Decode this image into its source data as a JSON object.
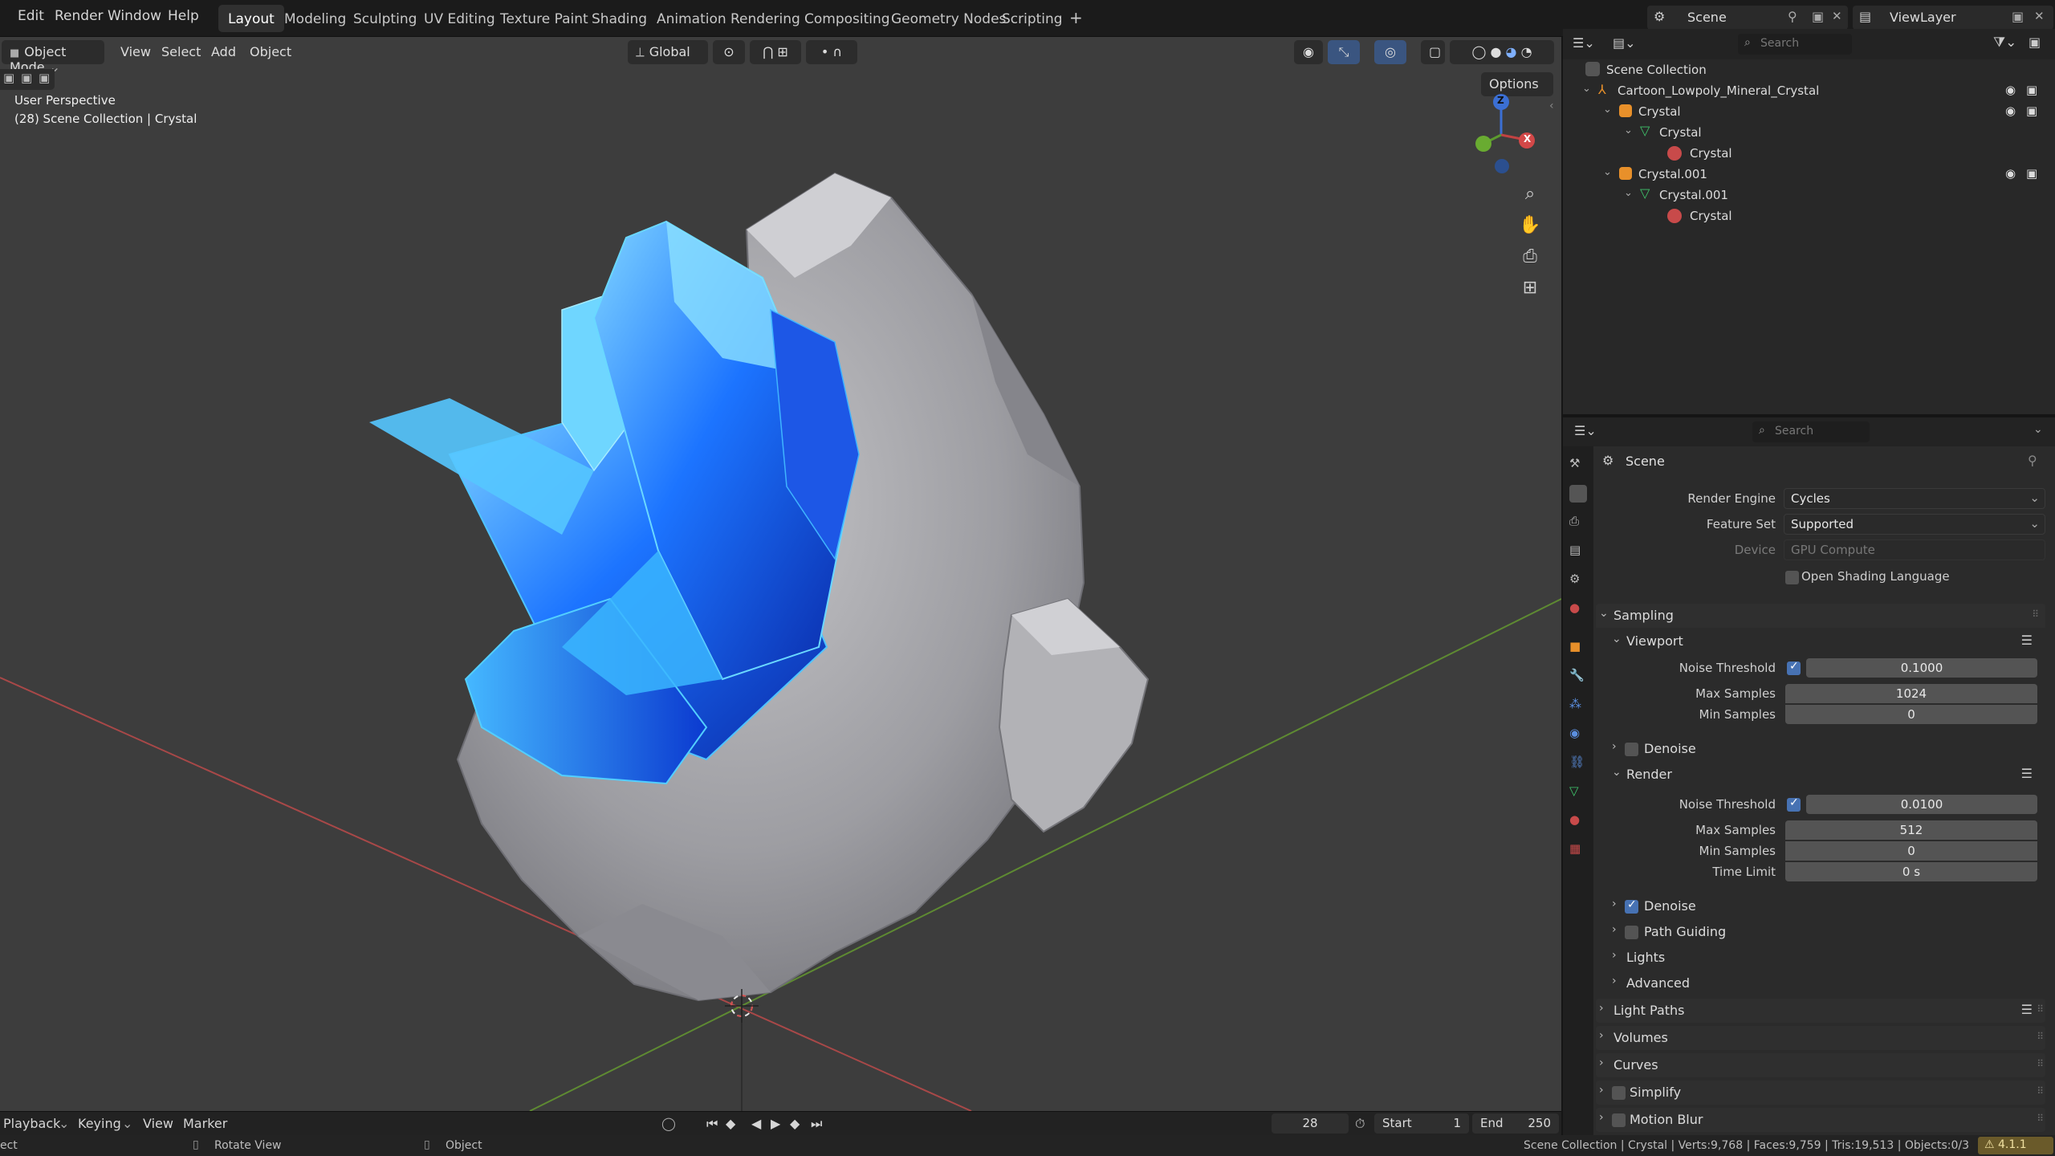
{
  "topbar": {
    "menus": [
      "Edit",
      "Render",
      "Window",
      "Help"
    ],
    "workspaces": [
      "Layout",
      "Modeling",
      "Sculpting",
      "UV Editing",
      "Texture Paint",
      "Shading",
      "Animation",
      "Rendering",
      "Compositing",
      "Geometry Nodes",
      "Scripting"
    ],
    "active_workspace": "Layout",
    "add_tab": "+",
    "scene_label": "Scene",
    "viewlayer_label": "ViewLayer"
  },
  "viewport": {
    "mode": "Object Mode",
    "menus": [
      "View",
      "Select",
      "Add",
      "Object"
    ],
    "orientation": "Global",
    "options_label": "Options",
    "overlay_line1": "User Perspective",
    "overlay_line2": "(28) Scene Collection | Crystal",
    "gizmo_z": "Z",
    "gizmo_x": "X"
  },
  "timeline": {
    "menus": [
      "Playback",
      "Keying",
      "View",
      "Marker"
    ],
    "current_frame": "28",
    "start_label": "Start",
    "start_value": "1",
    "end_label": "End",
    "end_value": "250"
  },
  "statusbar": {
    "left": "ect",
    "rotate_label": "Rotate View",
    "object_label": "Object",
    "stats": "Scene Collection | Crystal | Verts:9,768 | Faces:9,759 | Tris:19,513 | Objects:0/3",
    "version": "4.1.1"
  },
  "outliner": {
    "search_placeholder": "Search",
    "items": [
      {
        "label": "Scene Collection"
      },
      {
        "label": "Cartoon_Lowpoly_Mineral_Crystal"
      },
      {
        "label": "Crystal"
      },
      {
        "label": "Crystal"
      },
      {
        "label": "Crystal"
      },
      {
        "label": "Crystal.001"
      },
      {
        "label": "Crystal.001"
      },
      {
        "label": "Crystal"
      }
    ]
  },
  "properties": {
    "search_placeholder": "Search",
    "context": "Scene",
    "render_engine_label": "Render Engine",
    "render_engine_value": "Cycles",
    "feature_set_label": "Feature Set",
    "feature_set_value": "Supported",
    "device_label": "Device",
    "device_value": "GPU Compute",
    "osl_label": "Open Shading Language",
    "sampling_label": "Sampling",
    "viewport_label": "Viewport",
    "vp_noise_label": "Noise Threshold",
    "vp_noise_value": "0.1000",
    "vp_max_label": "Max Samples",
    "vp_max_value": "1024",
    "vp_min_label": "Min Samples",
    "vp_min_value": "0",
    "vp_denoise_label": "Denoise",
    "render_label": "Render",
    "r_noise_label": "Noise Threshold",
    "r_noise_value": "0.0100",
    "r_max_label": "Max Samples",
    "r_max_value": "512",
    "r_min_label": "Min Samples",
    "r_min_value": "0",
    "r_time_label": "Time Limit",
    "r_time_value": "0 s",
    "r_denoise_label": "Denoise",
    "path_guiding_label": "Path Guiding",
    "lights_label": "Lights",
    "advanced_label": "Advanced",
    "light_paths_label": "Light Paths",
    "volumes_label": "Volumes",
    "curves_label": "Curves",
    "simplify_label": "Simplify",
    "motion_blur_label": "Motion Blur"
  },
  "colors": {
    "accent": "#4772b3",
    "axis_x": "#b84a4a",
    "axis_y": "#6d9b3a",
    "crystal": "#1f78ff"
  }
}
